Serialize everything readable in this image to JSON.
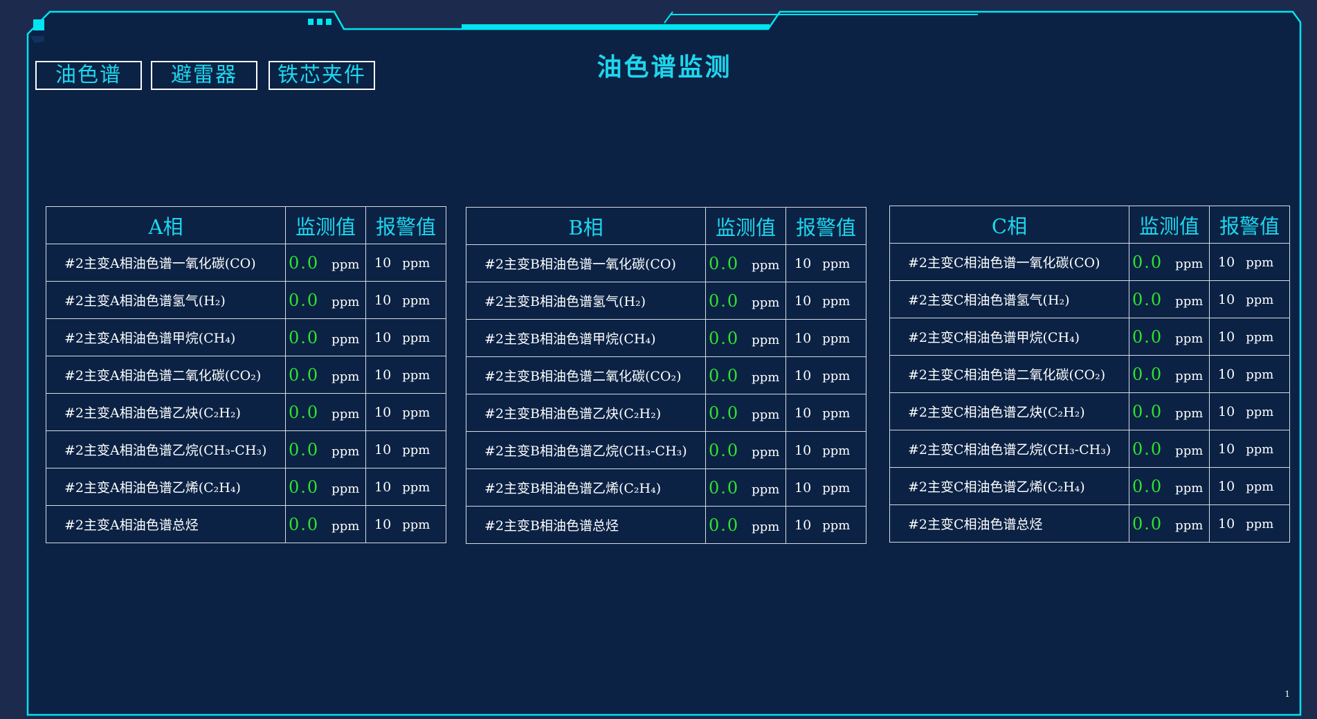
{
  "header": {
    "title": "油色谱监测",
    "nav": [
      "油色谱",
      "避雷器",
      "铁芯夹件"
    ]
  },
  "colors": {
    "background": "#0b2244",
    "frame": "#00e5f0",
    "accent_text": "#1ed6ee",
    "value_text": "#2ee32e"
  },
  "tables": [
    {
      "header": [
        "A相",
        "监测值",
        "报警值"
      ],
      "rows": [
        {
          "name": "#2主变A相油色谱一氧化碳(CO)",
          "value": "0.0",
          "unit": "ppm",
          "alarm": "10",
          "alarm_unit": "ppm"
        },
        {
          "name": "#2主变A相油色谱氢气(H₂)",
          "value": "0.0",
          "unit": "ppm",
          "alarm": "10",
          "alarm_unit": "ppm"
        },
        {
          "name": "#2主变A相油色谱甲烷(CH₄)",
          "value": "0.0",
          "unit": "ppm",
          "alarm": "10",
          "alarm_unit": "ppm"
        },
        {
          "name": "#2主变A相油色谱二氧化碳(CO₂)",
          "value": "0.0",
          "unit": "ppm",
          "alarm": "10",
          "alarm_unit": "ppm"
        },
        {
          "name": "#2主变A相油色谱乙炔(C₂H₂)",
          "value": "0.0",
          "unit": "ppm",
          "alarm": "10",
          "alarm_unit": "ppm"
        },
        {
          "name": "#2主变A相油色谱乙烷(CH₃-CH₃)",
          "value": "0.0",
          "unit": "ppm",
          "alarm": "10",
          "alarm_unit": "ppm"
        },
        {
          "name": "#2主变A相油色谱乙烯(C₂H₄)",
          "value": "0.0",
          "unit": "ppm",
          "alarm": "10",
          "alarm_unit": "ppm"
        },
        {
          "name": "#2主变A相油色谱总烃",
          "value": "0.0",
          "unit": "ppm",
          "alarm": "10",
          "alarm_unit": "ppm"
        }
      ]
    },
    {
      "header": [
        "B相",
        "监测值",
        "报警值"
      ],
      "rows": [
        {
          "name": "#2主变B相油色谱一氧化碳(CO)",
          "value": "0.0",
          "unit": "ppm",
          "alarm": "10",
          "alarm_unit": "ppm"
        },
        {
          "name": "#2主变B相油色谱氢气(H₂)",
          "value": "0.0",
          "unit": "ppm",
          "alarm": "10",
          "alarm_unit": "ppm"
        },
        {
          "name": "#2主变B相油色谱甲烷(CH₄)",
          "value": "0.0",
          "unit": "ppm",
          "alarm": "10",
          "alarm_unit": "ppm"
        },
        {
          "name": "#2主变B相油色谱二氧化碳(CO₂)",
          "value": "0.0",
          "unit": "ppm",
          "alarm": "10",
          "alarm_unit": "ppm"
        },
        {
          "name": "#2主变B相油色谱乙炔(C₂H₂)",
          "value": "0.0",
          "unit": "ppm",
          "alarm": "10",
          "alarm_unit": "ppm"
        },
        {
          "name": "#2主变B相油色谱乙烷(CH₃-CH₃)",
          "value": "0.0",
          "unit": "ppm",
          "alarm": "10",
          "alarm_unit": "ppm"
        },
        {
          "name": "#2主变B相油色谱乙烯(C₂H₄)",
          "value": "0.0",
          "unit": "ppm",
          "alarm": "10",
          "alarm_unit": "ppm"
        },
        {
          "name": "#2主变B相油色谱总烃",
          "value": "0.0",
          "unit": "ppm",
          "alarm": "10",
          "alarm_unit": "ppm"
        }
      ]
    },
    {
      "header": [
        "C相",
        "监测值",
        "报警值"
      ],
      "rows": [
        {
          "name": "#2主变C相油色谱一氧化碳(CO)",
          "value": "0.0",
          "unit": "ppm",
          "alarm": "10",
          "alarm_unit": "ppm"
        },
        {
          "name": "#2主变C相油色谱氢气(H₂)",
          "value": "0.0",
          "unit": "ppm",
          "alarm": "10",
          "alarm_unit": "ppm"
        },
        {
          "name": "#2主变C相油色谱甲烷(CH₄)",
          "value": "0.0",
          "unit": "ppm",
          "alarm": "10",
          "alarm_unit": "ppm"
        },
        {
          "name": "#2主变C相油色谱二氧化碳(CO₂)",
          "value": "0.0",
          "unit": "ppm",
          "alarm": "10",
          "alarm_unit": "ppm"
        },
        {
          "name": "#2主变C相油色谱乙炔(C₂H₂)",
          "value": "0.0",
          "unit": "ppm",
          "alarm": "10",
          "alarm_unit": "ppm"
        },
        {
          "name": "#2主变C相油色谱乙烷(CH₃-CH₃)",
          "value": "0.0",
          "unit": "ppm",
          "alarm": "10",
          "alarm_unit": "ppm"
        },
        {
          "name": "#2主变C相油色谱乙烯(C₂H₄)",
          "value": "0.0",
          "unit": "ppm",
          "alarm": "10",
          "alarm_unit": "ppm"
        },
        {
          "name": "#2主变C相油色谱总烃",
          "value": "0.0",
          "unit": "ppm",
          "alarm": "10",
          "alarm_unit": "ppm"
        }
      ]
    }
  ],
  "footer": {
    "page_number": "1"
  }
}
